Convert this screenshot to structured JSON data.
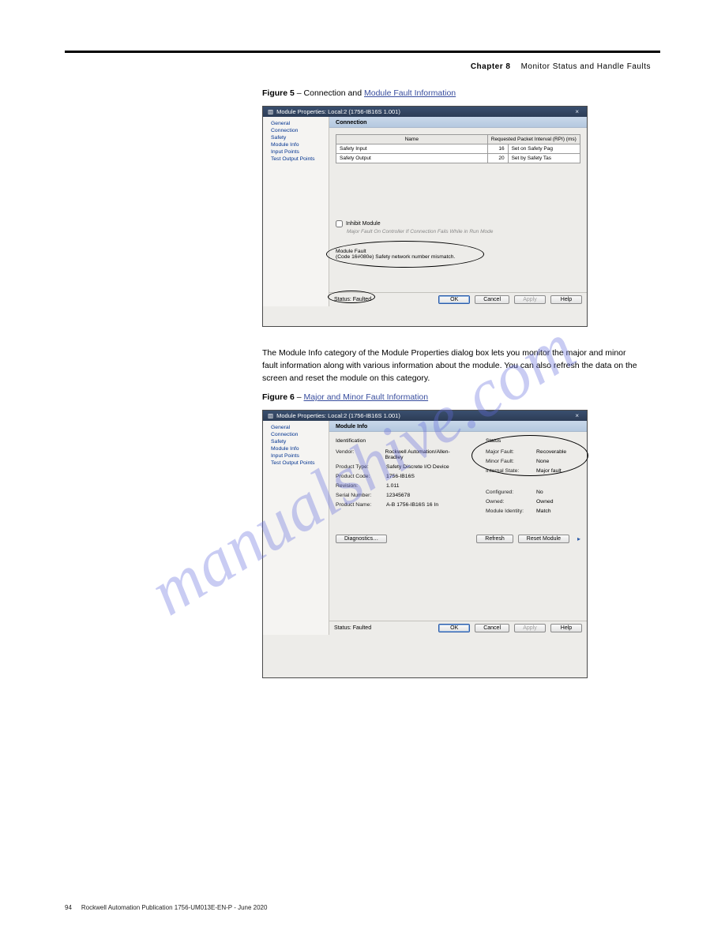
{
  "page": {
    "breadcrumb_link": "Chapter 8",
    "breadcrumb_text": "Monitor Status and Handle Faults",
    "fig5_caption_prefix": "Figure 5",
    "fig5_caption_text": " – Connection and ",
    "fig5_caption_link": "Module Fault Information",
    "fig6_caption_prefix": "Figure 6",
    "fig6_caption_text": " – ",
    "fig6_caption_link": "Major and Minor Fault Information",
    "paragraph": "The Module Info category of the Module Properties dialog box lets you monitor the major and minor fault information along with various information about the module. You can also refresh the data on the screen and reset the module on this category."
  },
  "win": {
    "title": "Module Properties: Local:2 (1756-IB16S 1.001)",
    "nav": [
      "General",
      "Connection",
      "Safety",
      "Module Info",
      "Input Points",
      "Test Output Points"
    ]
  },
  "conn": {
    "header": "Connection",
    "th_name": "Name",
    "th_rpi": "Requested Packet Interval (RPI) (ms)",
    "row1_name": "Safety Input",
    "row1_rpi": "16",
    "row1_note": "Set on Safety Pag",
    "row2_name": "Safety Output",
    "row2_rpi": "20",
    "row2_note": "Set by Safety Tas",
    "inhibit": "Inhibit Module",
    "majornote": "Major Fault On Controller If Connection Fails While in Run Mode",
    "fault_label": "Module Fault",
    "fault_text": "(Code 16#080e) Safety network number mismatch.",
    "status_label": "Status: Faulted",
    "ok": "OK",
    "cancel": "Cancel",
    "apply": "Apply",
    "help": "Help"
  },
  "mi": {
    "header": "Module Info",
    "ident": "Identification",
    "vendor_lbl": "Vendor:",
    "vendor": "Rockwell Automation/Allen-Bradley",
    "ptype_lbl": "Product Type:",
    "ptype": "Safety Discrete I/O Device",
    "pcode_lbl": "Product Code:",
    "pcode": "1756-IB16S",
    "rev_lbl": "Revision:",
    "rev": "1.011",
    "serial_lbl": "Serial Number:",
    "serial": "12345678",
    "pname_lbl": "Product Name:",
    "pname": "A-B 1756-IB16S 16 In",
    "status": "Status",
    "majfault_lbl": "Major Fault:",
    "majfault": "Recoverable",
    "minfault_lbl": "Minor Fault:",
    "minfault": "None",
    "istate_lbl": "Internal State:",
    "istate": "Major fault",
    "cfg_lbl": "Configured:",
    "cfg": "No",
    "owned_lbl": "Owned:",
    "owned": "Owned",
    "midnt_lbl": "Module Identity:",
    "midnt": "Match",
    "diag": "Diagnostics…",
    "refresh": "Refresh",
    "reset": "Reset Module",
    "ok": "OK",
    "cancel": "Cancel",
    "apply": "Apply",
    "help": "Help",
    "status_label": "Status: Faulted"
  },
  "footer": {
    "pageno": "94",
    "pub": "Rockwell Automation Publication 1756-UM013E-EN-P - June 2020"
  },
  "watermark": "manualshive.com"
}
